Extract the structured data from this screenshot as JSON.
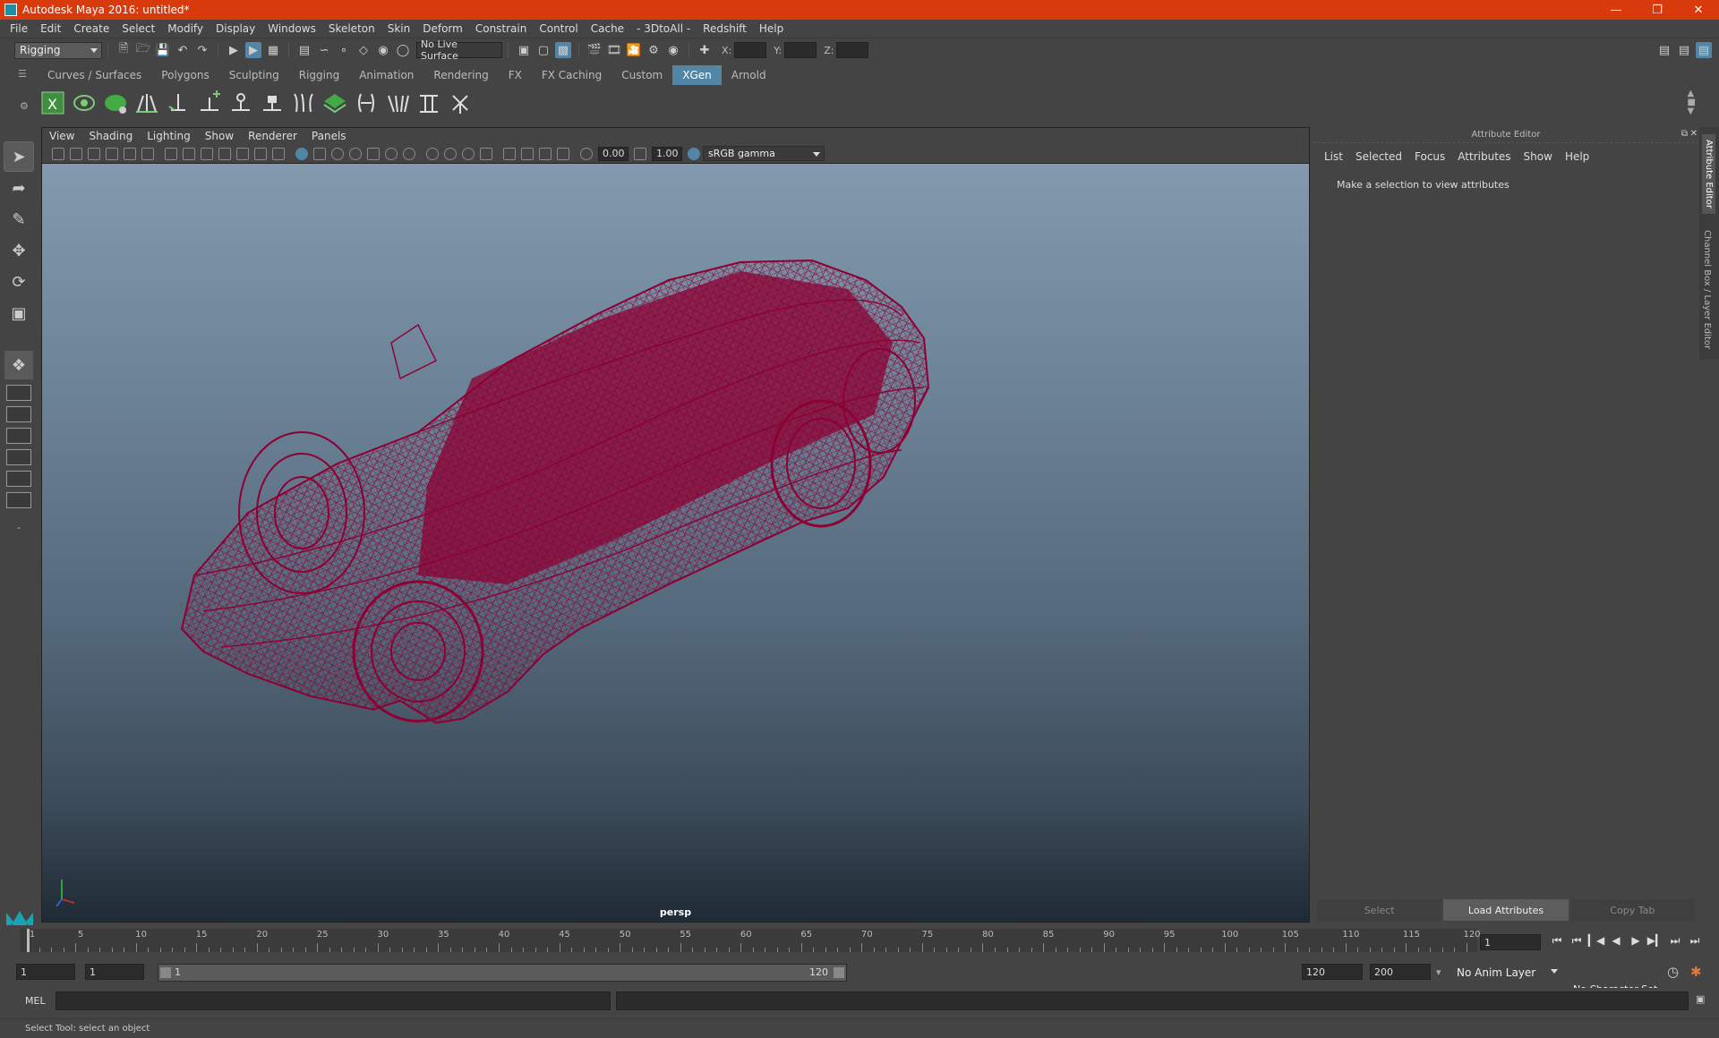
{
  "window": {
    "title": "Autodesk Maya 2016: untitled*"
  },
  "menubar": [
    "File",
    "Edit",
    "Create",
    "Select",
    "Modify",
    "Display",
    "Windows",
    "Skeleton",
    "Skin",
    "Deform",
    "Constrain",
    "Control",
    "Cache",
    "- 3DtoAll -",
    "Redshift",
    "Help"
  ],
  "statusline": {
    "menuset": "Rigging",
    "live_surface": "No Live Surface",
    "x_label": "X:",
    "y_label": "Y:",
    "z_label": "Z:"
  },
  "shelf": {
    "tabs": [
      "Curves / Surfaces",
      "Polygons",
      "Sculpting",
      "Rigging",
      "Animation",
      "Rendering",
      "FX",
      "FX Caching",
      "Custom",
      "XGen",
      "Arnold"
    ],
    "active_tab": "XGen"
  },
  "viewport": {
    "menu": [
      "View",
      "Shading",
      "Lighting",
      "Show",
      "Renderer",
      "Panels"
    ],
    "exposure": "0.00",
    "gamma": "1.00",
    "color_space": "sRGB gamma",
    "camera_label": "persp",
    "wireframe_color": "#8c0033"
  },
  "attribute_editor": {
    "header": "Attribute Editor",
    "menu": [
      "List",
      "Selected",
      "Focus",
      "Attributes",
      "Show",
      "Help"
    ],
    "message": "Make a selection to view attributes",
    "buttons": {
      "select": "Select",
      "load": "Load Attributes",
      "copy": "Copy Tab"
    }
  },
  "side_tabs": {
    "attr": "Attribute Editor",
    "channel": "Channel Box / Layer Editor"
  },
  "timeline": {
    "ticks": [
      "1",
      "5",
      "10",
      "15",
      "20",
      "25",
      "30",
      "35",
      "40",
      "45",
      "50",
      "55",
      "60",
      "65",
      "70",
      "75",
      "80",
      "85",
      "90",
      "95",
      "100",
      "105",
      "110",
      "115",
      "120"
    ],
    "current_frame": "1"
  },
  "range": {
    "start": "1",
    "anim_start": "1",
    "slider_start": "1",
    "slider_end": "120",
    "anim_end": "120",
    "end": "200",
    "anim_layer": "No Anim Layer",
    "character_set": "No Character Set"
  },
  "cmdline": {
    "label": "MEL"
  },
  "helpline": {
    "text": "Select Tool: select an object"
  },
  "colors": {
    "title_bar": "#d93a0c",
    "accent": "#5285a6",
    "panel": "#444444"
  }
}
